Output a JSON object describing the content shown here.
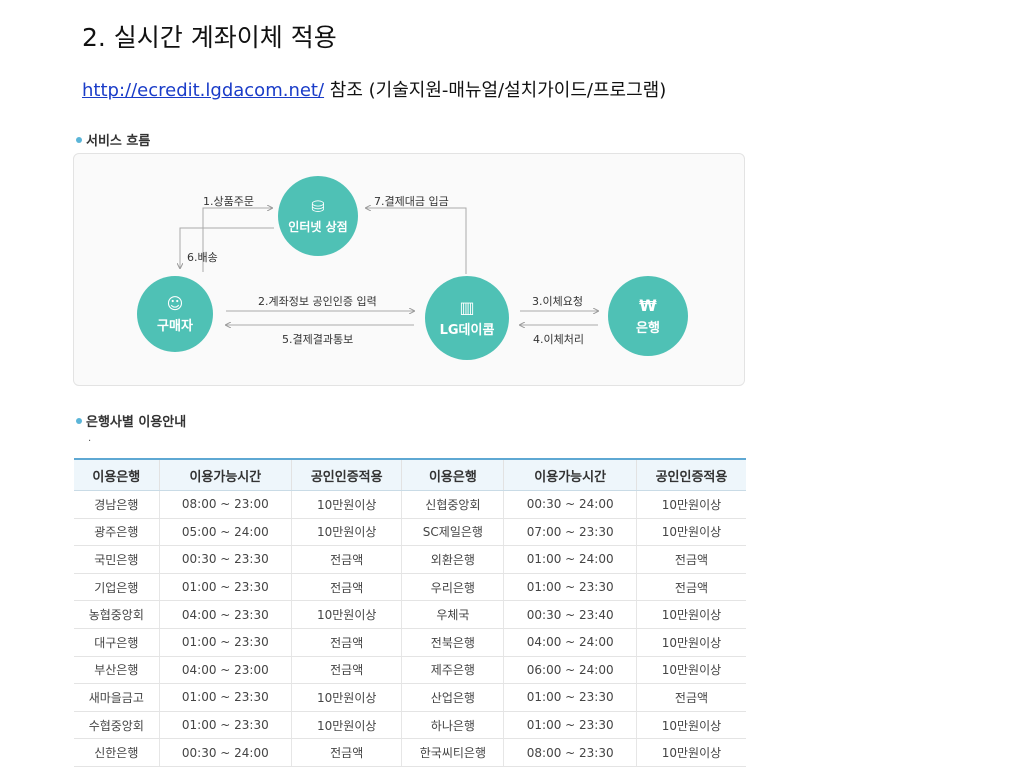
{
  "slide": {
    "title": "2. 실시간 계좌이체 적용",
    "link": "http://ecredit.lgdacom.net/",
    "link_suffix": " 참조 (기술지원-매뉴얼/설치가이드/프로그램)"
  },
  "service_flow": {
    "heading": "서비스 흐름",
    "nodes": {
      "store": "인터넷 상점",
      "buyer": "구매자",
      "lg": "LG데이콤",
      "bank": "은행"
    },
    "steps": {
      "s1": "1.상품주문",
      "s2": "2.계좌정보 공인인증 입력",
      "s3": "3.이체요청",
      "s4": "4.이체처리",
      "s5": "5.결제결과통보",
      "s6": "6.배송",
      "s7": "7.결제대금 입금"
    }
  },
  "bank_guide": {
    "heading": "은행사별 이용안내",
    "dot": ".",
    "columns": [
      "이용은행",
      "이용가능시간",
      "공인인증적용",
      "이용은행",
      "이용가능시간",
      "공인인증적용"
    ],
    "rows": [
      [
        "경남은행",
        "08:00 ~ 23:00",
        "10만원이상",
        "신협중앙회",
        "00:30 ~ 24:00",
        "10만원이상"
      ],
      [
        "광주은행",
        "05:00 ~ 24:00",
        "10만원이상",
        "SC제일은행",
        "07:00 ~ 23:30",
        "10만원이상"
      ],
      [
        "국민은행",
        "00:30 ~ 23:30",
        "전금액",
        "외환은행",
        "01:00 ~ 24:00",
        "전금액"
      ],
      [
        "기업은행",
        "01:00 ~ 23:30",
        "전금액",
        "우리은행",
        "01:00 ~ 23:30",
        "전금액"
      ],
      [
        "농협중앙회",
        "04:00 ~ 23:30",
        "10만원이상",
        "우체국",
        "00:30 ~ 23:40",
        "10만원이상"
      ],
      [
        "대구은행",
        "01:00 ~ 23:30",
        "전금액",
        "전북은행",
        "04:00 ~ 24:00",
        "10만원이상"
      ],
      [
        "부산은행",
        "04:00 ~ 23:00",
        "전금액",
        "제주은행",
        "06:00 ~ 24:00",
        "10만원이상"
      ],
      [
        "새마을금고",
        "01:00 ~ 23:30",
        "10만원이상",
        "산업은행",
        "01:00 ~ 23:30",
        "전금액"
      ],
      [
        "수협중앙회",
        "01:00 ~ 23:30",
        "10만원이상",
        "하나은행",
        "01:00 ~ 23:30",
        "10만원이상"
      ],
      [
        "신한은행",
        "00:30 ~ 24:00",
        "전금액",
        "한국씨티은행",
        "08:00 ~ 23:30",
        "10만원이상"
      ]
    ]
  },
  "colors": {
    "accent": "#4fc1b5",
    "table_border": "#5ea8d3",
    "header_bg": "#eef6fb",
    "link": "#1a3cc8"
  }
}
